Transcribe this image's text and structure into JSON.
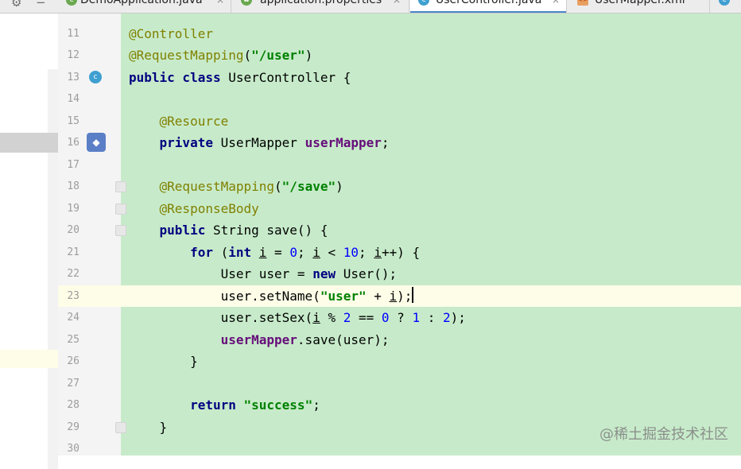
{
  "tabbar": {
    "settings_icon": "gear-icon",
    "collapse_icon": "minus-icon",
    "tabs": [
      {
        "label": "DemoApplication.java",
        "icon": "spring-boot-class-icon",
        "active": false
      },
      {
        "label": "application.properties",
        "icon": "spring-properties-icon",
        "active": false
      },
      {
        "label": "UserController.java",
        "icon": "java-class-icon",
        "active": true
      },
      {
        "label": "UserMapper.xml",
        "icon": "xml-file-icon",
        "active": false
      },
      {
        "label": "",
        "icon": "java-class-icon",
        "active": false
      }
    ],
    "close_glyph": "×"
  },
  "editor": {
    "caret_line": "23",
    "lines": [
      {
        "n": "11",
        "tokens": [
          {
            "t": "@Controller",
            "c": "ann"
          }
        ]
      },
      {
        "n": "12",
        "tokens": [
          {
            "t": "@RequestMapping",
            "c": "ann"
          },
          {
            "t": "(",
            "c": "punc"
          },
          {
            "t": "\"/user\"",
            "c": "str"
          },
          {
            "t": ")",
            "c": "punc"
          }
        ]
      },
      {
        "n": "13",
        "tokens": [
          {
            "t": "public class",
            "c": "kw"
          },
          {
            "t": " UserController {",
            "c": "plain"
          }
        ]
      },
      {
        "n": "14",
        "tokens": []
      },
      {
        "n": "15",
        "tokens": [
          {
            "t": "    ",
            "c": "plain"
          },
          {
            "t": "@Resource",
            "c": "ann"
          }
        ]
      },
      {
        "n": "16",
        "tokens": [
          {
            "t": "    ",
            "c": "plain"
          },
          {
            "t": "private",
            "c": "kw"
          },
          {
            "t": " UserMapper ",
            "c": "plain"
          },
          {
            "t": "userMapper",
            "c": "fld"
          },
          {
            "t": ";",
            "c": "punc"
          }
        ]
      },
      {
        "n": "17",
        "tokens": []
      },
      {
        "n": "18",
        "tokens": [
          {
            "t": "    ",
            "c": "plain"
          },
          {
            "t": "@RequestMapping",
            "c": "ann"
          },
          {
            "t": "(",
            "c": "punc"
          },
          {
            "t": "\"/save\"",
            "c": "str"
          },
          {
            "t": ")",
            "c": "punc"
          }
        ]
      },
      {
        "n": "19",
        "tokens": [
          {
            "t": "    ",
            "c": "plain"
          },
          {
            "t": "@ResponseBody",
            "c": "ann"
          }
        ]
      },
      {
        "n": "20",
        "tokens": [
          {
            "t": "    ",
            "c": "plain"
          },
          {
            "t": "public",
            "c": "kw"
          },
          {
            "t": " String save() {",
            "c": "plain"
          }
        ]
      },
      {
        "n": "21",
        "tokens": [
          {
            "t": "        ",
            "c": "plain"
          },
          {
            "t": "for",
            "c": "kw"
          },
          {
            "t": " (",
            "c": "plain"
          },
          {
            "t": "int",
            "c": "kw"
          },
          {
            "t": " ",
            "c": "plain"
          },
          {
            "t": "i",
            "c": "var"
          },
          {
            "t": " = ",
            "c": "plain"
          },
          {
            "t": "0",
            "c": "num"
          },
          {
            "t": "; ",
            "c": "plain"
          },
          {
            "t": "i",
            "c": "var"
          },
          {
            "t": " < ",
            "c": "plain"
          },
          {
            "t": "10",
            "c": "num"
          },
          {
            "t": "; ",
            "c": "plain"
          },
          {
            "t": "i",
            "c": "var"
          },
          {
            "t": "++) {",
            "c": "plain"
          }
        ]
      },
      {
        "n": "22",
        "tokens": [
          {
            "t": "            User user = ",
            "c": "plain"
          },
          {
            "t": "new",
            "c": "kw"
          },
          {
            "t": " User();",
            "c": "plain"
          }
        ]
      },
      {
        "n": "23",
        "tokens": [
          {
            "t": "            user.setName(",
            "c": "plain"
          },
          {
            "t": "\"user\"",
            "c": "str"
          },
          {
            "t": " + ",
            "c": "plain"
          },
          {
            "t": "i",
            "c": "var"
          },
          {
            "t": ");",
            "c": "plain"
          },
          {
            "t": "",
            "c": "cursor"
          }
        ]
      },
      {
        "n": "24",
        "tokens": [
          {
            "t": "            user.setSex(",
            "c": "plain"
          },
          {
            "t": "i",
            "c": "var"
          },
          {
            "t": " % ",
            "c": "plain"
          },
          {
            "t": "2",
            "c": "num"
          },
          {
            "t": " == ",
            "c": "plain"
          },
          {
            "t": "0",
            "c": "num"
          },
          {
            "t": " ? ",
            "c": "plain"
          },
          {
            "t": "1",
            "c": "num"
          },
          {
            "t": " : ",
            "c": "plain"
          },
          {
            "t": "2",
            "c": "num"
          },
          {
            "t": ");",
            "c": "plain"
          }
        ]
      },
      {
        "n": "25",
        "tokens": [
          {
            "t": "            ",
            "c": "plain"
          },
          {
            "t": "userMapper",
            "c": "fld"
          },
          {
            "t": ".save(user);",
            "c": "plain"
          }
        ]
      },
      {
        "n": "26",
        "tokens": [
          {
            "t": "        }",
            "c": "plain"
          }
        ]
      },
      {
        "n": "27",
        "tokens": []
      },
      {
        "n": "28",
        "tokens": [
          {
            "t": "        ",
            "c": "plain"
          },
          {
            "t": "return",
            "c": "kw"
          },
          {
            "t": " ",
            "c": "plain"
          },
          {
            "t": "\"success\"",
            "c": "str"
          },
          {
            "t": ";",
            "c": "punc"
          }
        ]
      },
      {
        "n": "29",
        "tokens": [
          {
            "t": "    }",
            "c": "plain"
          }
        ]
      },
      {
        "n": "30",
        "tokens": []
      }
    ],
    "gutter_icons": [
      {
        "line": "13",
        "icon": "class-c",
        "name": "spring-controller-icon",
        "glyph": "c"
      },
      {
        "line": "16",
        "icon": "bean",
        "name": "autowired-bean-icon",
        "glyph": "◆"
      }
    ],
    "fold_markers": [
      "18",
      "19",
      "20",
      "29"
    ]
  },
  "watermark": "@稀土掘金技术社区",
  "colors": {
    "code_background": "#c7ebca",
    "caret_line": "#fdfde8",
    "keyword": "#000080",
    "annotation": "#808000",
    "string": "#008000",
    "number": "#0000ff",
    "field": "#660e7a"
  }
}
